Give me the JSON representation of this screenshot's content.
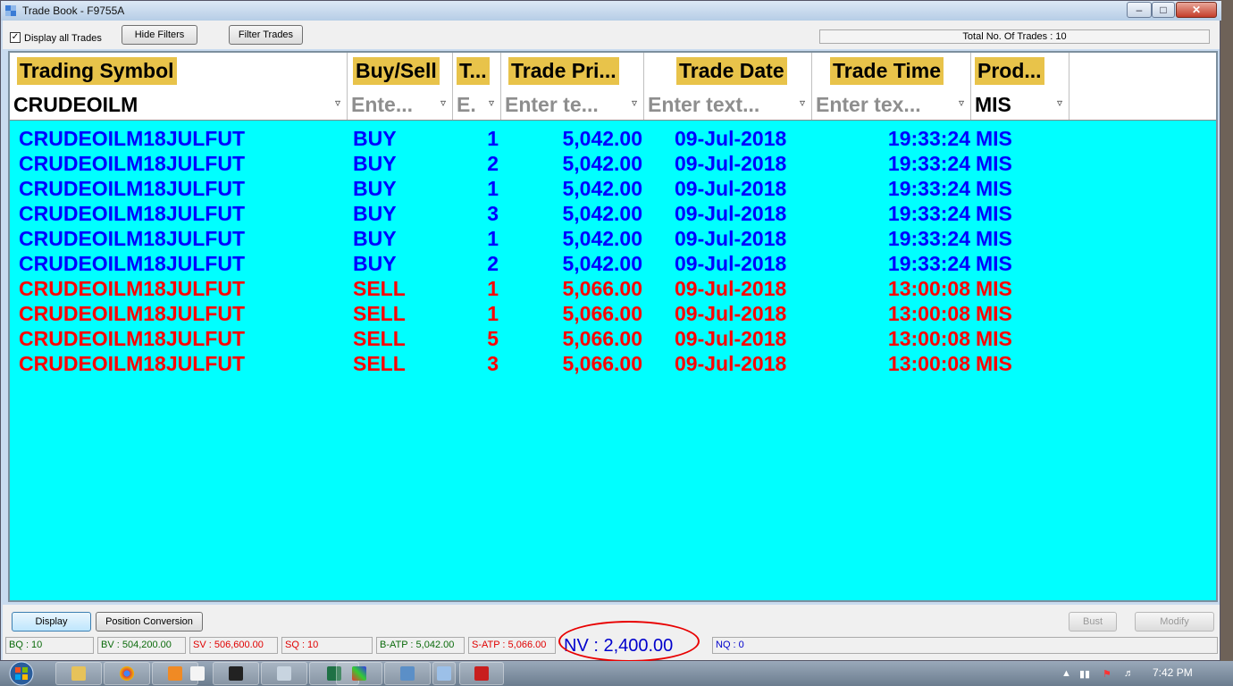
{
  "window": {
    "title": "Trade Book - F9755A"
  },
  "toolbar": {
    "display_all_label": "Display all Trades",
    "display_all_checked": true,
    "hide_filters_label": "Hide Filters",
    "filter_trades_label": "Filter Trades",
    "total_trades": "Total No. Of Trades : 10"
  },
  "grid": {
    "headers": [
      "Trading Symbol",
      "Buy/Sell",
      "T...",
      "Trade Pri...",
      "Trade Date",
      "Trade Time",
      "Prod..."
    ],
    "filters": [
      "CRUDEOILM",
      "Ente...",
      "E.",
      "Enter te...",
      "Enter text...",
      "Enter tex...",
      "MIS"
    ],
    "rows": [
      {
        "symbol": "CRUDEOILM18JULFUT",
        "side": "BUY",
        "qty": "1",
        "price": "5,042.00",
        "date": "09-Jul-2018",
        "time": "19:33:24",
        "product": "MIS"
      },
      {
        "symbol": "CRUDEOILM18JULFUT",
        "side": "BUY",
        "qty": "2",
        "price": "5,042.00",
        "date": "09-Jul-2018",
        "time": "19:33:24",
        "product": "MIS"
      },
      {
        "symbol": "CRUDEOILM18JULFUT",
        "side": "BUY",
        "qty": "1",
        "price": "5,042.00",
        "date": "09-Jul-2018",
        "time": "19:33:24",
        "product": "MIS"
      },
      {
        "symbol": "CRUDEOILM18JULFUT",
        "side": "BUY",
        "qty": "3",
        "price": "5,042.00",
        "date": "09-Jul-2018",
        "time": "19:33:24",
        "product": "MIS"
      },
      {
        "symbol": "CRUDEOILM18JULFUT",
        "side": "BUY",
        "qty": "1",
        "price": "5,042.00",
        "date": "09-Jul-2018",
        "time": "19:33:24",
        "product": "MIS"
      },
      {
        "symbol": "CRUDEOILM18JULFUT",
        "side": "BUY",
        "qty": "2",
        "price": "5,042.00",
        "date": "09-Jul-2018",
        "time": "19:33:24",
        "product": "MIS"
      },
      {
        "symbol": "CRUDEOILM18JULFUT",
        "side": "SELL",
        "qty": "1",
        "price": "5,066.00",
        "date": "09-Jul-2018",
        "time": "13:00:08",
        "product": "MIS"
      },
      {
        "symbol": "CRUDEOILM18JULFUT",
        "side": "SELL",
        "qty": "1",
        "price": "5,066.00",
        "date": "09-Jul-2018",
        "time": "13:00:08",
        "product": "MIS"
      },
      {
        "symbol": "CRUDEOILM18JULFUT",
        "side": "SELL",
        "qty": "5",
        "price": "5,066.00",
        "date": "09-Jul-2018",
        "time": "13:00:08",
        "product": "MIS"
      },
      {
        "symbol": "CRUDEOILM18JULFUT",
        "side": "SELL",
        "qty": "3",
        "price": "5,066.00",
        "date": "09-Jul-2018",
        "time": "13:00:08",
        "product": "MIS"
      }
    ]
  },
  "bottom": {
    "display_label": "Display",
    "position_conversion_label": "Position Conversion",
    "bust_label": "Bust",
    "modify_label": "Modify"
  },
  "status": {
    "bq": "BQ : 10",
    "bv": "BV : 504,200.00",
    "sv": "SV : 506,600.00",
    "sq": "SQ : 10",
    "batp": "B-ATP : 5,042.00",
    "satp": "S-ATP : 5,066.00",
    "nv": "NV : 2,400.00",
    "nq": "NQ : 0"
  },
  "taskbar": {
    "clock": "7:42 PM"
  },
  "colors": {
    "grid_background": "#00ffff",
    "buy": "#0000ff",
    "sell": "#ff0000",
    "header_highlight": "#e8c34a",
    "annotation_ring": "#e80000"
  }
}
